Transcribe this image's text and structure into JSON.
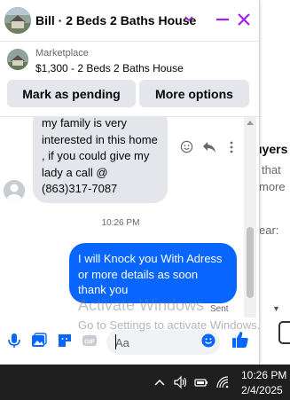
{
  "chat": {
    "title": "Bill · 2 Beds 2 Baths House",
    "listing": {
      "source": "Marketplace",
      "title": "$1,300 - 2 Beds 2 Baths House"
    },
    "buttons": {
      "mark_pending": "Mark as pending",
      "more_options": "More options"
    }
  },
  "thread": {
    "incoming_text": "my family is very interested in this home , if you could give my lady a call @ (863)317-7087",
    "timestamp": "10:26 PM",
    "outgoing_text": "I will Knock you With Adress or more details  as soon thank you",
    "status": "Sent"
  },
  "composer": {
    "placeholder": "Aa"
  },
  "background_page": {
    "heading": "uyers",
    "line1": "that",
    "line2": "more",
    "line3": "ear:"
  },
  "watermark": {
    "line1": "Activate Windows",
    "line2": "Go to Settings to activate Windows."
  },
  "taskbar": {
    "time": "10:26 PM",
    "date": "2/4/2025"
  },
  "colors": {
    "accent": "#a020f0",
    "messenger_blue": "#0866ff",
    "like_blue": "#0866ff"
  }
}
